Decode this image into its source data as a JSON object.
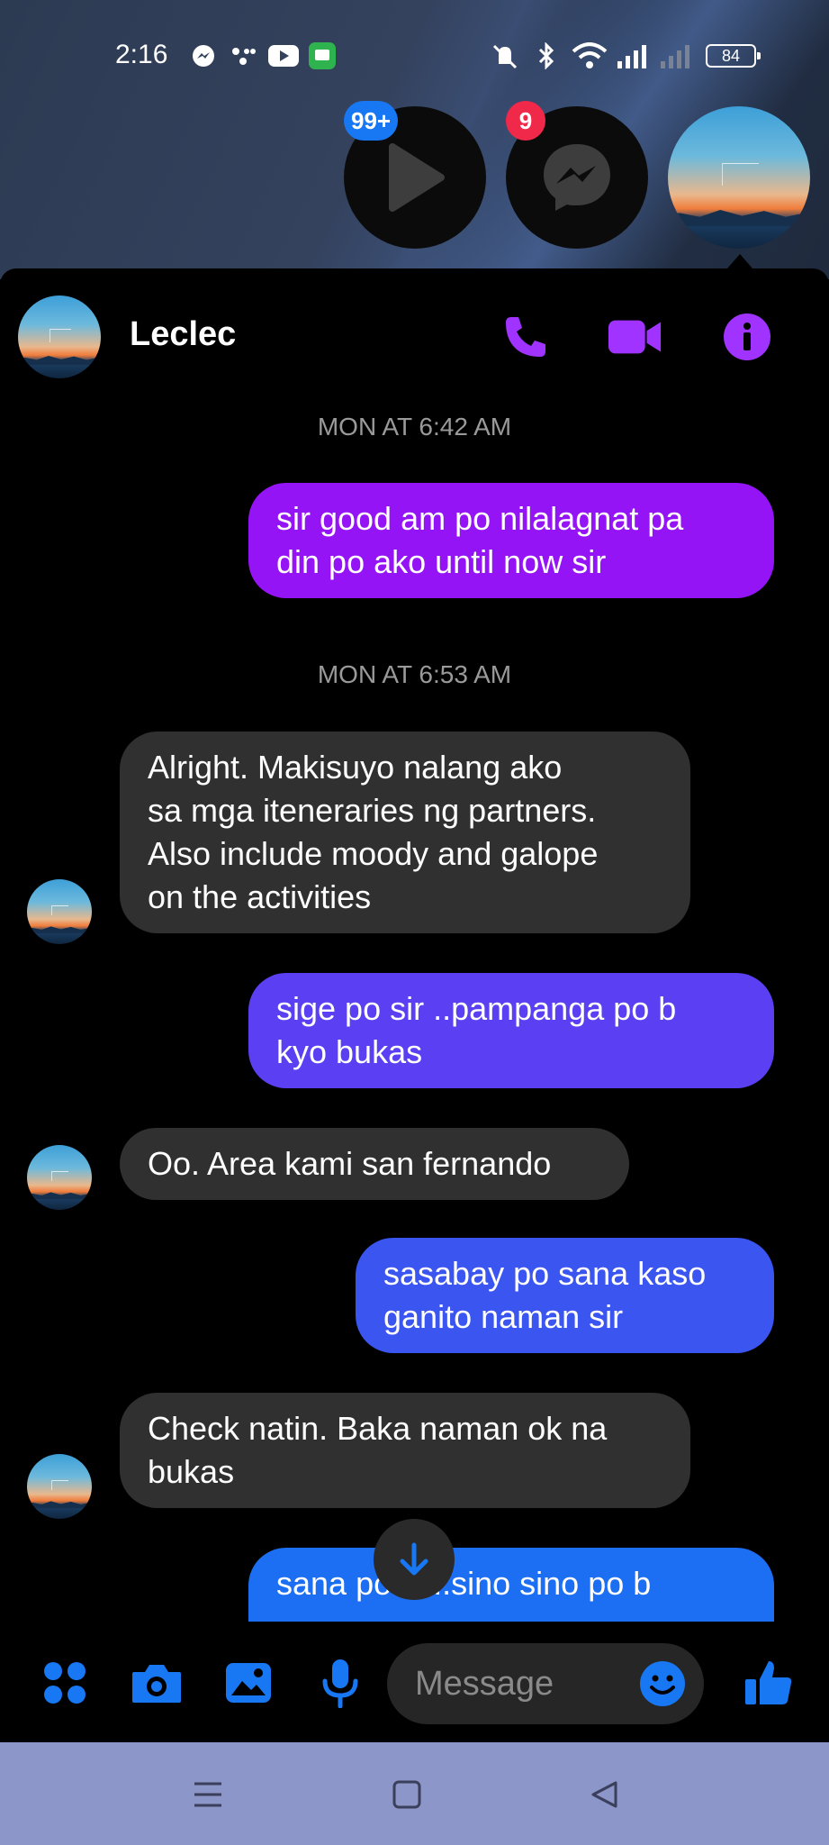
{
  "status_bar": {
    "time": "2:16",
    "battery": "84",
    "notification_icons": [
      "messenger-icon",
      "dots-icon",
      "youtube-icon",
      "messages-icon"
    ],
    "system_icons": [
      "mute-icon",
      "bluetooth-icon",
      "wifi-icon",
      "signal-icon",
      "signal-2-icon"
    ]
  },
  "chat_heads": [
    {
      "name": "video-player",
      "badge": "99+",
      "badge_color": "#1877f2"
    },
    {
      "name": "messenger",
      "badge": "9",
      "badge_color": "#f02849"
    },
    {
      "name": "leclec-avatar",
      "badge": ""
    }
  ],
  "header": {
    "contact_name": "Leclec",
    "accent": "#a033ff"
  },
  "timestamps": [
    "MON AT 6:42 AM",
    "MON AT 6:53 AM"
  ],
  "messages": [
    {
      "dir": "out",
      "text": "sir good am po nilalagnat pa\ndin po ako until now sir",
      "color": "#9414f6"
    },
    {
      "dir": "in",
      "text": "Alright. Makisuyo nalang ako\nsa mga iteneraries ng partners.\nAlso include moody and galope\non the activities"
    },
    {
      "dir": "out",
      "text": "sige po sir ..pampanga po b\nkyo bukas",
      "color": "#5b3ff2"
    },
    {
      "dir": "in",
      "text": "Oo. Area kami san fernando"
    },
    {
      "dir": "out",
      "text": "sasabay po sana kaso\nganito naman sir",
      "color": "#3a55f0"
    },
    {
      "dir": "in",
      "text": "Check natin. Baka naman ok na\nbukas"
    },
    {
      "dir": "out",
      "text": "sana po sir..sino sino po b",
      "color": "#1c6ef2"
    }
  ],
  "composer": {
    "placeholder": "Message",
    "accent": "#1877f2"
  }
}
